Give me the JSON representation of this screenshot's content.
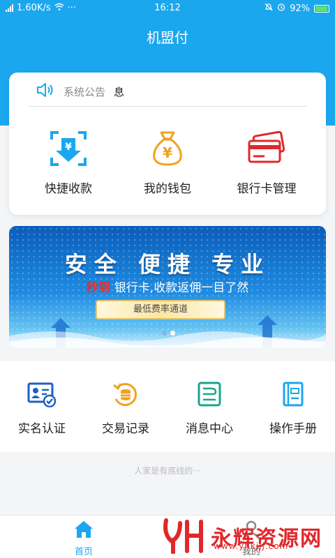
{
  "status_bar": {
    "network": "1.60K/s",
    "time": "16:12",
    "battery": "92%"
  },
  "header": {
    "title": "机盟付"
  },
  "notice": {
    "label": "系统公告",
    "value": "息"
  },
  "quick_actions": [
    {
      "label": "快捷收款",
      "icon": "qr-scan-yen-icon"
    },
    {
      "label": "我的钱包",
      "icon": "money-bag-icon"
    },
    {
      "label": "银行卡管理",
      "icon": "bank-card-icon"
    }
  ],
  "banner": {
    "headline": "安全 便捷 专业",
    "highlight": "秒到",
    "subline": "银行卡,收款返佣一目了然",
    "pill": "最低费率通道",
    "active_slide": 2,
    "slide_count": 2
  },
  "features": [
    {
      "label": "实名认证",
      "icon": "id-card-check-icon"
    },
    {
      "label": "交易记录",
      "icon": "coin-history-icon"
    },
    {
      "label": "消息中心",
      "icon": "message-center-icon"
    },
    {
      "label": "操作手册",
      "icon": "manual-book-icon"
    }
  ],
  "bottom_text": "人家是有底线的···",
  "tabbar": {
    "home": {
      "label": "首页"
    },
    "mine": {
      "label": "我的"
    }
  },
  "watermark": {
    "brand": "永辉资源网",
    "url": "www.yhkjjj.com"
  },
  "colors": {
    "primary": "#1ba7ee",
    "accent_orange": "#f0a21e",
    "accent_red": "#e0282a"
  }
}
